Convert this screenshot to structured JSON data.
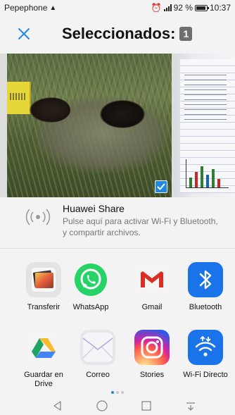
{
  "status_bar": {
    "carrier": "Pepephone",
    "battery": "92 %",
    "time": "10:37"
  },
  "header": {
    "title": "Seleccionados:",
    "count": "1"
  },
  "huawei_share": {
    "title": "Huawei Share",
    "description": "Pulse aquí para activar Wi-Fi y Bluetooth, y compartir archivos."
  },
  "apps": [
    {
      "label": "Transferir",
      "icon": "transfer-icon"
    },
    {
      "label": "WhatsApp",
      "icon": "whatsapp-icon"
    },
    {
      "label": "Gmail",
      "icon": "gmail-icon"
    },
    {
      "label": "Bluetooth",
      "icon": "bluetooth-icon"
    },
    {
      "label": "Guardar en Drive",
      "icon": "drive-icon"
    },
    {
      "label": "Correo",
      "icon": "mail-icon"
    },
    {
      "label": "Stories",
      "icon": "instagram-icon"
    },
    {
      "label": "Wi-Fi Directo",
      "icon": "wifi-direct-icon"
    }
  ],
  "colors": {
    "accent": "#1e88e5",
    "whatsapp": "#25d366",
    "bluetooth": "#1a73e8",
    "gmail_red": "#d93025"
  },
  "pager": {
    "current_page": 1,
    "total_pages": 3
  }
}
